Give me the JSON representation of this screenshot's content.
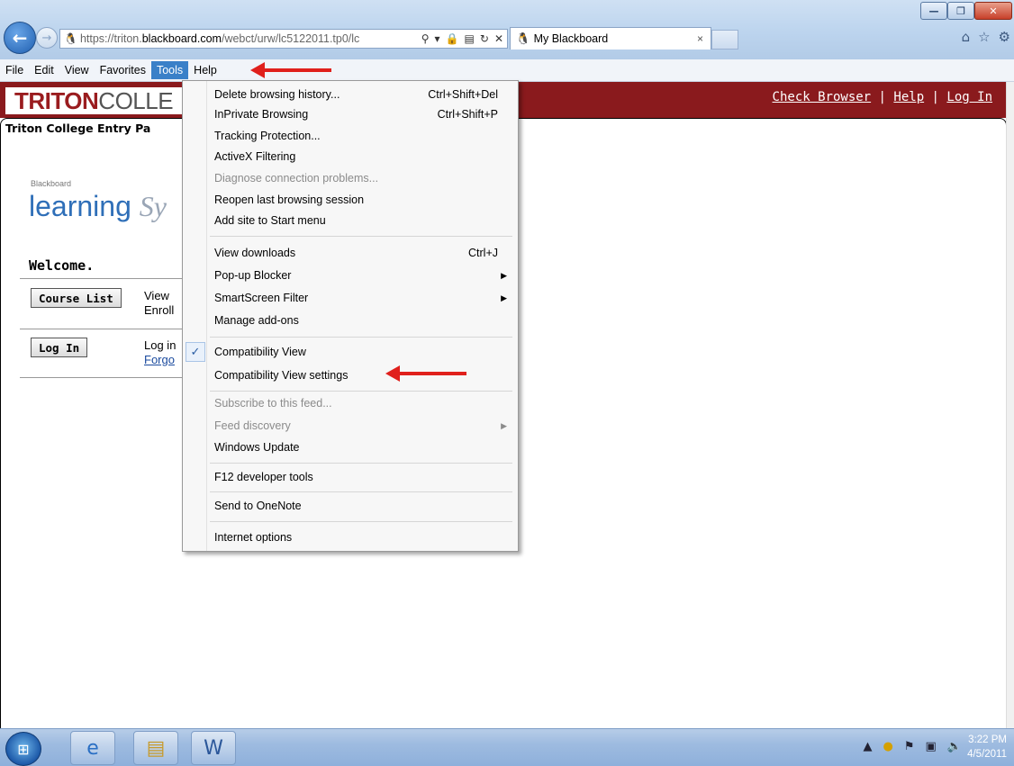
{
  "browser": {
    "url_prefix": "https://triton.",
    "url_domain": "blackboard.com",
    "url_rest": "/webct/urw/lc5122011.tp0/lc",
    "tab_title": "My Blackboard",
    "menus": [
      "File",
      "Edit",
      "View",
      "Favorites",
      "Tools",
      "Help"
    ],
    "window_controls": {
      "minimize": "—",
      "maximize": "❐",
      "close": "✕"
    }
  },
  "page": {
    "logo_bold": "TRITON",
    "logo_rest": "COLLE",
    "top_links": {
      "check_browser": "Check Browser",
      "sep1": " | ",
      "help": "Help",
      "sep2": " | ",
      "login": "Log In"
    },
    "entry_tab": "Triton College Entry Pa",
    "bb_small": "Blackboard",
    "bb_learning": "learning",
    "bb_system": "Sy",
    "welcome": "Welcome.",
    "course_list_btn": "Course List",
    "course_list_text1": "View",
    "course_list_text2": "Enroll",
    "login_btn": "Log In",
    "login_text1": "Log in",
    "login_text2": "Forgo"
  },
  "tools_menu": {
    "items": [
      {
        "label": "Delete browsing history...",
        "shortcut": "Ctrl+Shift+Del"
      },
      {
        "label": "InPrivate Browsing",
        "shortcut": "Ctrl+Shift+P"
      },
      {
        "label": "Tracking Protection..."
      },
      {
        "label": "ActiveX Filtering"
      },
      {
        "label": "Diagnose connection problems...",
        "disabled": true
      },
      {
        "label": "Reopen last browsing session"
      },
      {
        "label": "Add site to Start menu"
      },
      {
        "label": "View downloads",
        "shortcut": "Ctrl+J"
      },
      {
        "label": "Pop-up Blocker",
        "submenu": true
      },
      {
        "label": "SmartScreen Filter",
        "submenu": true
      },
      {
        "label": "Manage add-ons"
      },
      {
        "label": "Compatibility View",
        "checked": true
      },
      {
        "label": "Compatibility View settings"
      },
      {
        "label": "Subscribe to this feed...",
        "disabled": true
      },
      {
        "label": "Feed discovery",
        "disabled": true,
        "submenu": true
      },
      {
        "label": "Windows Update"
      },
      {
        "label": "F12 developer tools"
      },
      {
        "label": "Send to OneNote"
      },
      {
        "label": "Internet options"
      }
    ]
  },
  "taskbar": {
    "time": "3:22 PM",
    "date": "4/5/2011"
  },
  "colors": {
    "brand_red": "#8a1a1d",
    "arrow_red": "#e0201c",
    "menu_highlight": "#3a80c8"
  }
}
